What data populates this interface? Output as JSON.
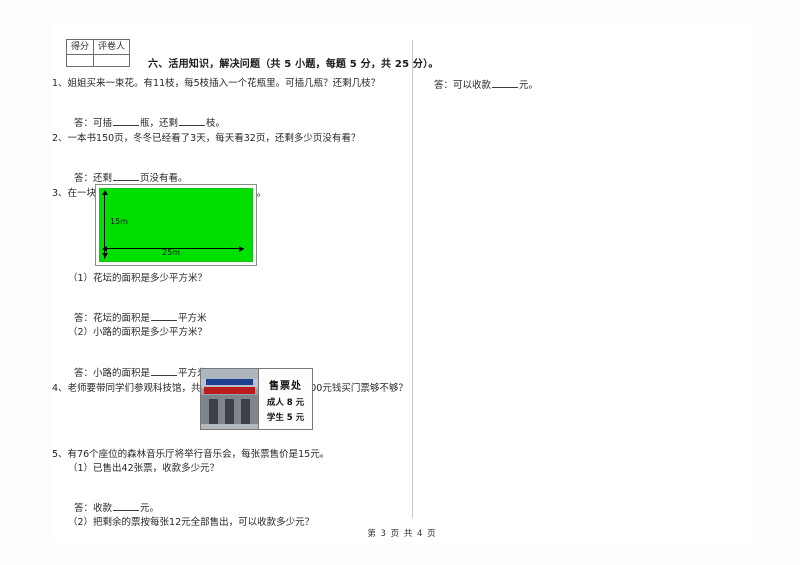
{
  "score_table": {
    "headers": [
      "得分",
      "评卷人"
    ]
  },
  "section": {
    "title": "六、活用知识，解决问题（共 5 小题，每题 5 分，共 25 分）。"
  },
  "questions": [
    {
      "number": "1、",
      "text": "姐姐买来一束花。有11枝，每5枝插入一个花瓶里。可插几瓶？还剩几枝？",
      "answer_prefix": "答：可插",
      "answer_mid": "瓶，还剩",
      "answer_suffix": "枝。"
    },
    {
      "number": "2、",
      "text": "一本书150页，冬冬已经看了3天，每天看32页，还剩多少页没有看？",
      "answer_prefix": "答：还剩",
      "answer_suffix": "页没有看。"
    },
    {
      "number": "3、",
      "text": "在一块长方形的花坛四周，铺上宽1m 的小路。",
      "sub1": "（1）花坛的面积是多少平方米？",
      "sub1_answer_prefix": "答：花坛的面积是",
      "sub1_answer_suffix": "平方米",
      "sub2": "（2）小路的面积是多少平方米？",
      "sub2_answer_prefix": "答：小路的面积是",
      "sub2_answer_suffix": "平方米。"
    },
    {
      "number": "4、",
      "text": "老师要带同学们参观科技馆，共有5名老师和88名学生。500元钱买门票够不够？"
    },
    {
      "number": "5、",
      "text": "有76个座位的森林音乐厅将举行音乐会，每张票售价是15元。",
      "sub1": "（1）已售出42张票，收款多少元？",
      "sub1_answer_prefix": "答：收款",
      "sub1_answer_suffix": "元。",
      "sub2": "（2）把剩余的票按每张12元全部售出，可以收款多少元？"
    }
  ],
  "figure": {
    "height_label": "15m",
    "width_label": "25m",
    "fill_color": "#00e000"
  },
  "ticket_sign": {
    "title": "售票处",
    "adult": "成人 8 元",
    "student": "学生 5 元"
  },
  "right_column": {
    "answer_prefix": "答：可以收款",
    "answer_suffix": "元。"
  },
  "footer": {
    "text": "第 3 页 共 4 页"
  }
}
